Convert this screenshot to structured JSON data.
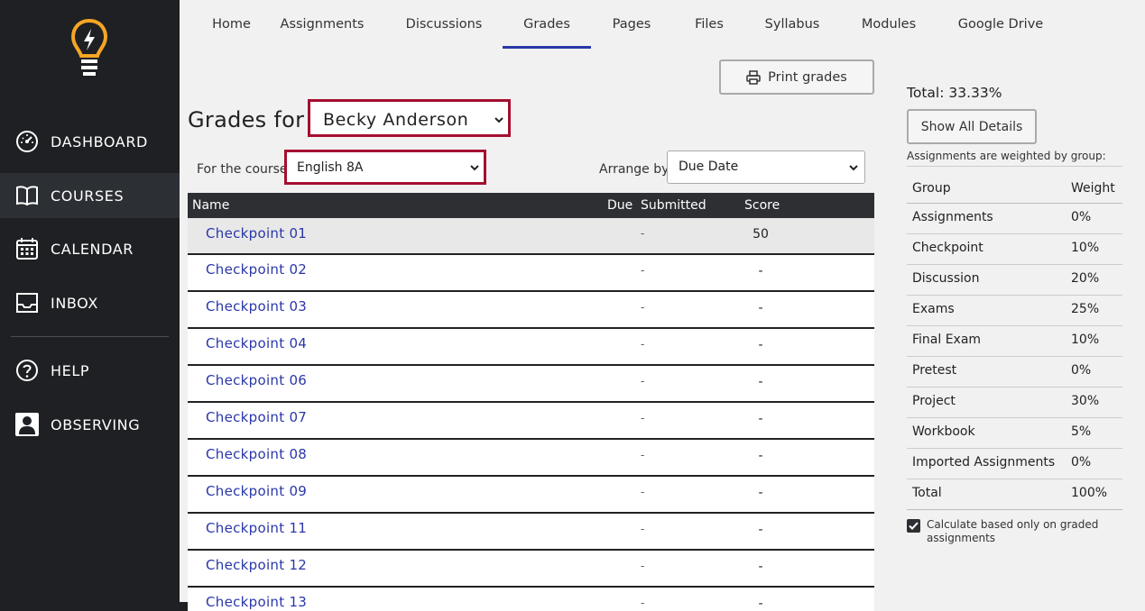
{
  "sidebar": {
    "items": [
      {
        "label": "DASHBOARD",
        "icon": "dashboard-icon"
      },
      {
        "label": "COURSES",
        "icon": "book-icon",
        "active": true
      },
      {
        "label": "CALENDAR",
        "icon": "calendar-icon"
      },
      {
        "label": "INBOX",
        "icon": "inbox-icon"
      },
      {
        "label": "HELP",
        "icon": "help-icon"
      },
      {
        "label": "OBSERVING",
        "icon": "observing-icon"
      }
    ]
  },
  "tabs": [
    {
      "label": "Home"
    },
    {
      "label": "Assignments"
    },
    {
      "label": "Discussions"
    },
    {
      "label": "Grades",
      "active": true
    },
    {
      "label": "Pages"
    },
    {
      "label": "Files"
    },
    {
      "label": "Syllabus"
    },
    {
      "label": "Modules"
    },
    {
      "label": "Google Drive"
    }
  ],
  "main": {
    "print_label": "Print grades",
    "grades_for": "Grades for",
    "student": "Becky Anderson",
    "for_course_label": "For the course",
    "course": "English 8A",
    "arrange_label": "Arrange by",
    "arrange_value": "Due Date"
  },
  "table": {
    "columns": {
      "name": "Name",
      "due": "Due",
      "submitted": "Submitted",
      "score": "Score"
    },
    "rows": [
      {
        "name": "Checkpoint 01",
        "submitted": "-",
        "score": "50"
      },
      {
        "name": "Checkpoint 02",
        "submitted": "-",
        "score": "-"
      },
      {
        "name": "Checkpoint 03",
        "submitted": "-",
        "score": "-"
      },
      {
        "name": "Checkpoint 04",
        "submitted": "-",
        "score": "-"
      },
      {
        "name": "Checkpoint 06",
        "submitted": "-",
        "score": "-"
      },
      {
        "name": "Checkpoint 07",
        "submitted": "-",
        "score": "-"
      },
      {
        "name": "Checkpoint 08",
        "submitted": "-",
        "score": "-"
      },
      {
        "name": "Checkpoint 09",
        "submitted": "-",
        "score": "-"
      },
      {
        "name": "Checkpoint 11",
        "submitted": "-",
        "score": "-"
      },
      {
        "name": "Checkpoint 12",
        "submitted": "-",
        "score": "-"
      },
      {
        "name": "Checkpoint 13",
        "submitted": "-",
        "score": "-"
      }
    ]
  },
  "summary": {
    "total": "Total: 33.33%",
    "show_details": "Show All Details",
    "weight_note": "Assignments are weighted by group:",
    "head": {
      "group": "Group",
      "weight": "Weight"
    },
    "groups": [
      {
        "group": "Assignments",
        "weight": "0%"
      },
      {
        "group": "Checkpoint",
        "weight": "10%"
      },
      {
        "group": "Discussion",
        "weight": "20%"
      },
      {
        "group": "Exams",
        "weight": "25%"
      },
      {
        "group": "Final Exam",
        "weight": "10%"
      },
      {
        "group": "Pretest",
        "weight": "0%"
      },
      {
        "group": "Project",
        "weight": "30%"
      },
      {
        "group": "Workbook",
        "weight": "5%"
      },
      {
        "group": "Imported Assignments",
        "weight": "0%"
      },
      {
        "group": "Total",
        "weight": "100%"
      }
    ],
    "calc_label": "Calculate based only on graded assignments",
    "calc_checked": true
  },
  "colors": {
    "sidebar_bg": "#1e2023",
    "accent": "#2a37a8",
    "highlight_border": "#a50e30",
    "logo": "#f5a623"
  }
}
